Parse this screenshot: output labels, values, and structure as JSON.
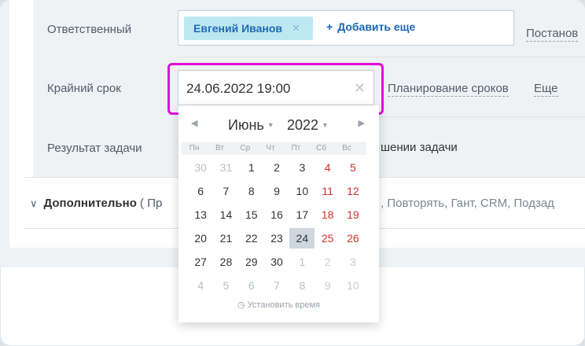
{
  "form": {
    "responsible_label": "Ответственный",
    "responsible_user": "Евгений Иванов",
    "add_more_label": "Добавить еще",
    "director_link": "Постанов",
    "deadline_label": "Крайний срок",
    "deadline_value": "24.06.2022 19:00",
    "planning_link": "Планирование сроков",
    "more_link": "Еще",
    "result_label": "Результат задачи",
    "result_text": "шении задачи",
    "additional_label": "Дополнительно",
    "additional_hint": "( Пр",
    "additional_links": ", Повторять, Гант, CRM, Подзад"
  },
  "calendar": {
    "month": "Июнь",
    "year": "2022",
    "weekdays": [
      "Пн",
      "Вт",
      "Ср",
      "Чт",
      "Пт",
      "Сб",
      "Вс"
    ],
    "weeks": [
      [
        {
          "d": "30",
          "o": true
        },
        {
          "d": "31",
          "o": true
        },
        {
          "d": "1"
        },
        {
          "d": "2"
        },
        {
          "d": "3"
        },
        {
          "d": "4",
          "w": true
        },
        {
          "d": "5",
          "w": true
        }
      ],
      [
        {
          "d": "6"
        },
        {
          "d": "7"
        },
        {
          "d": "8"
        },
        {
          "d": "9"
        },
        {
          "d": "10"
        },
        {
          "d": "11",
          "w": true
        },
        {
          "d": "12",
          "w": true
        }
      ],
      [
        {
          "d": "13"
        },
        {
          "d": "14"
        },
        {
          "d": "15"
        },
        {
          "d": "16"
        },
        {
          "d": "17"
        },
        {
          "d": "18",
          "w": true
        },
        {
          "d": "19",
          "w": true
        }
      ],
      [
        {
          "d": "20"
        },
        {
          "d": "21"
        },
        {
          "d": "22"
        },
        {
          "d": "23"
        },
        {
          "d": "24",
          "s": true
        },
        {
          "d": "25",
          "w": true
        },
        {
          "d": "26",
          "w": true
        }
      ],
      [
        {
          "d": "27"
        },
        {
          "d": "28"
        },
        {
          "d": "29"
        },
        {
          "d": "30"
        },
        {
          "d": "1",
          "o": true
        },
        {
          "d": "2",
          "o": true
        },
        {
          "d": "3",
          "o": true
        }
      ],
      [
        {
          "d": "4",
          "o": true
        },
        {
          "d": "5",
          "o": true
        },
        {
          "d": "6",
          "o": true
        },
        {
          "d": "7",
          "o": true
        },
        {
          "d": "8",
          "o": true
        },
        {
          "d": "9",
          "o": true
        },
        {
          "d": "10",
          "o": true
        }
      ]
    ],
    "set_time_label": "Установить время"
  },
  "colors": {
    "highlight": "#e40ed8",
    "chip_bg": "#bce8f1",
    "weekend": "#d2312e"
  }
}
